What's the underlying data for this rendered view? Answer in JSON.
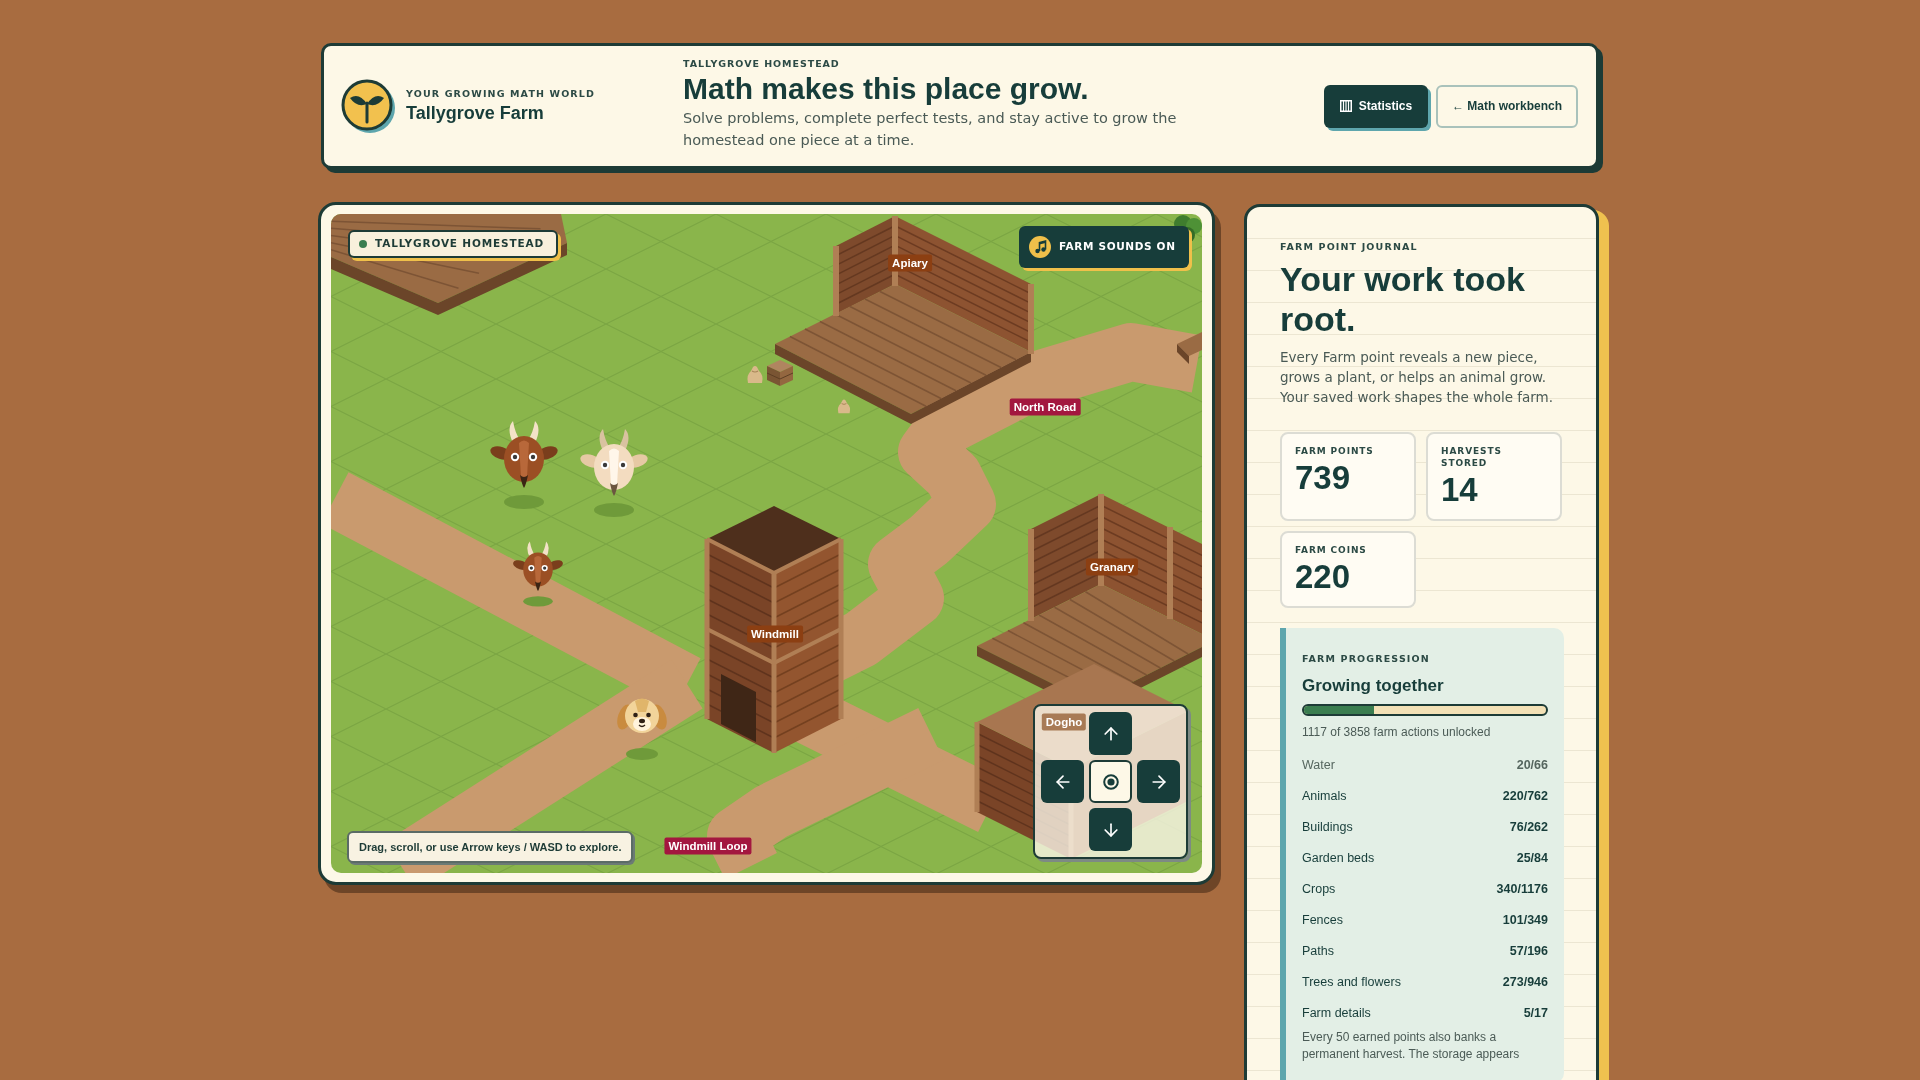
{
  "brand": {
    "tagline": "YOUR GROWING MATH WORLD",
    "name": "Tallygrove Farm"
  },
  "hero": {
    "kicker": "TALLYGROVE HOMESTEAD",
    "title": "Math makes this place grow.",
    "subtitle": "Solve problems, complete perfect tests, and stay active to grow the homestead one piece at a time."
  },
  "actions": [
    {
      "label": "Statistics",
      "kind": "primary"
    },
    {
      "label": "← Math workbench",
      "kind": "secondary"
    }
  ],
  "map": {
    "badge": "TALLYGROVE HOMESTEAD",
    "sound_button": "FARM SOUNDS ON",
    "labels": [
      {
        "text": "Apiary",
        "kind": "building"
      },
      {
        "text": "North Road",
        "kind": "road"
      },
      {
        "text": "Granary",
        "kind": "building"
      },
      {
        "text": "Windmill",
        "kind": "building"
      },
      {
        "text": "Dogho",
        "kind": "covered"
      },
      {
        "text": "Windmill Loop",
        "kind": "road"
      }
    ],
    "hint": "Drag, scroll, or use Arrow keys / WASD to explore."
  },
  "journal": {
    "kicker": "FARM POINT JOURNAL",
    "title": "Your work took root.",
    "body": "Every Farm point reveals a new piece, grows a plant, or helps an animal grow. Your saved work shapes the whole farm.",
    "stats": [
      {
        "label": "FARM POINTS",
        "value": "739"
      },
      {
        "label": "HARVESTS STORED",
        "value": "14"
      },
      {
        "label": "FARM COINS",
        "value": "220"
      }
    ],
    "progression": {
      "kicker": "FARM PROGRESSION",
      "title": "Growing together",
      "level": 0.29,
      "summary": "1117 of 3858 farm actions unlocked",
      "rows": [
        {
          "label": "Water",
          "value": "20/66",
          "dimmed": true
        },
        {
          "label": "Animals",
          "value": "220/762",
          "dimmed": false
        },
        {
          "label": "Buildings",
          "value": "76/262",
          "dimmed": false
        },
        {
          "label": "Garden beds",
          "value": "25/84",
          "dimmed": false
        },
        {
          "label": "Crops",
          "value": "340/1176",
          "dimmed": false
        },
        {
          "label": "Fences",
          "value": "101/349",
          "dimmed": false
        },
        {
          "label": "Paths",
          "value": "57/196",
          "dimmed": false
        },
        {
          "label": "Trees and flowers",
          "value": "273/946",
          "dimmed": false
        },
        {
          "label": "Farm details",
          "value": "5/17",
          "dimmed": false
        }
      ],
      "note": "Every 50 earned points also banks a permanent harvest. The storage appears"
    }
  }
}
